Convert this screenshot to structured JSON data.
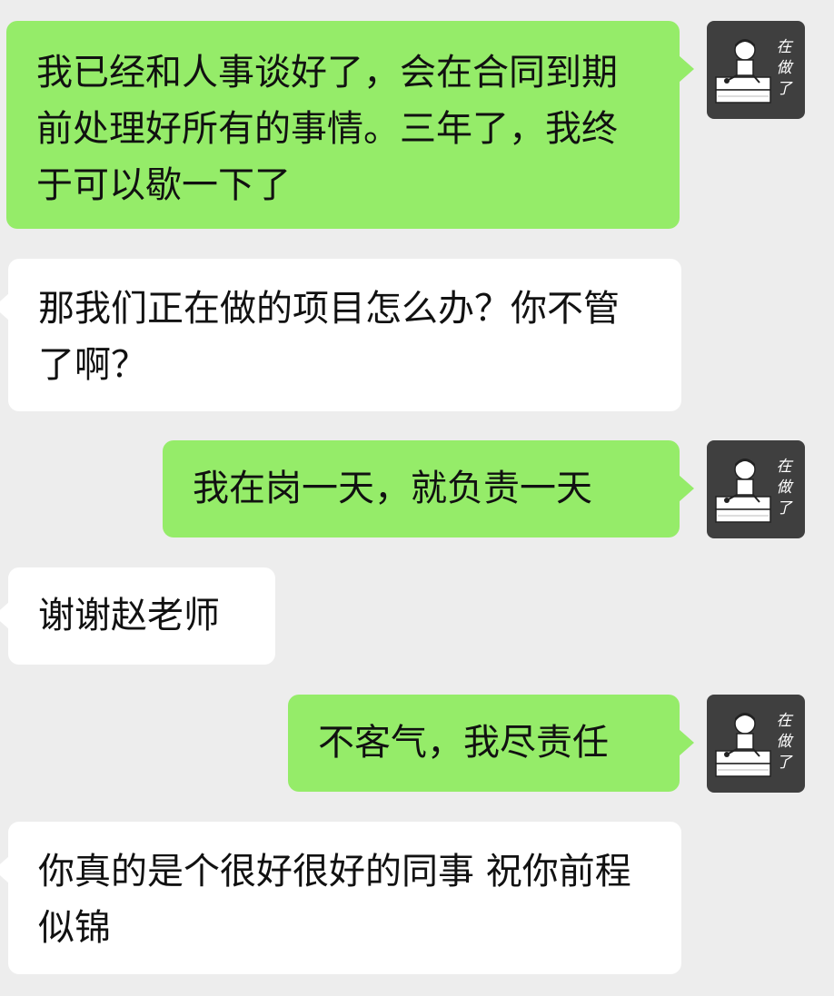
{
  "messages": [
    {
      "side": "out",
      "text": "我已经和人事谈好了，会在合同到期前处理好所有的事情。三年了，我终于可以歇一下了"
    },
    {
      "side": "in",
      "text": "那我们正在做的项目怎么办？你不管了啊？"
    },
    {
      "side": "out",
      "text": "我在岗一天，就负责一天"
    },
    {
      "side": "in",
      "text": "谢谢赵老师"
    },
    {
      "side": "out",
      "text": "不客气，我尽责任"
    },
    {
      "side": "in",
      "text": "你真的是个很好很好的同事 祝你前程似锦"
    }
  ],
  "avatar": {
    "caption_chars": [
      "在",
      "做",
      "了"
    ],
    "icon": "cartoon-person-sitting-icon"
  },
  "colors": {
    "background": "#ededed",
    "outgoing_bubble": "#95ec69",
    "incoming_bubble": "#ffffff",
    "avatar_bg": "#3f3f3f"
  }
}
